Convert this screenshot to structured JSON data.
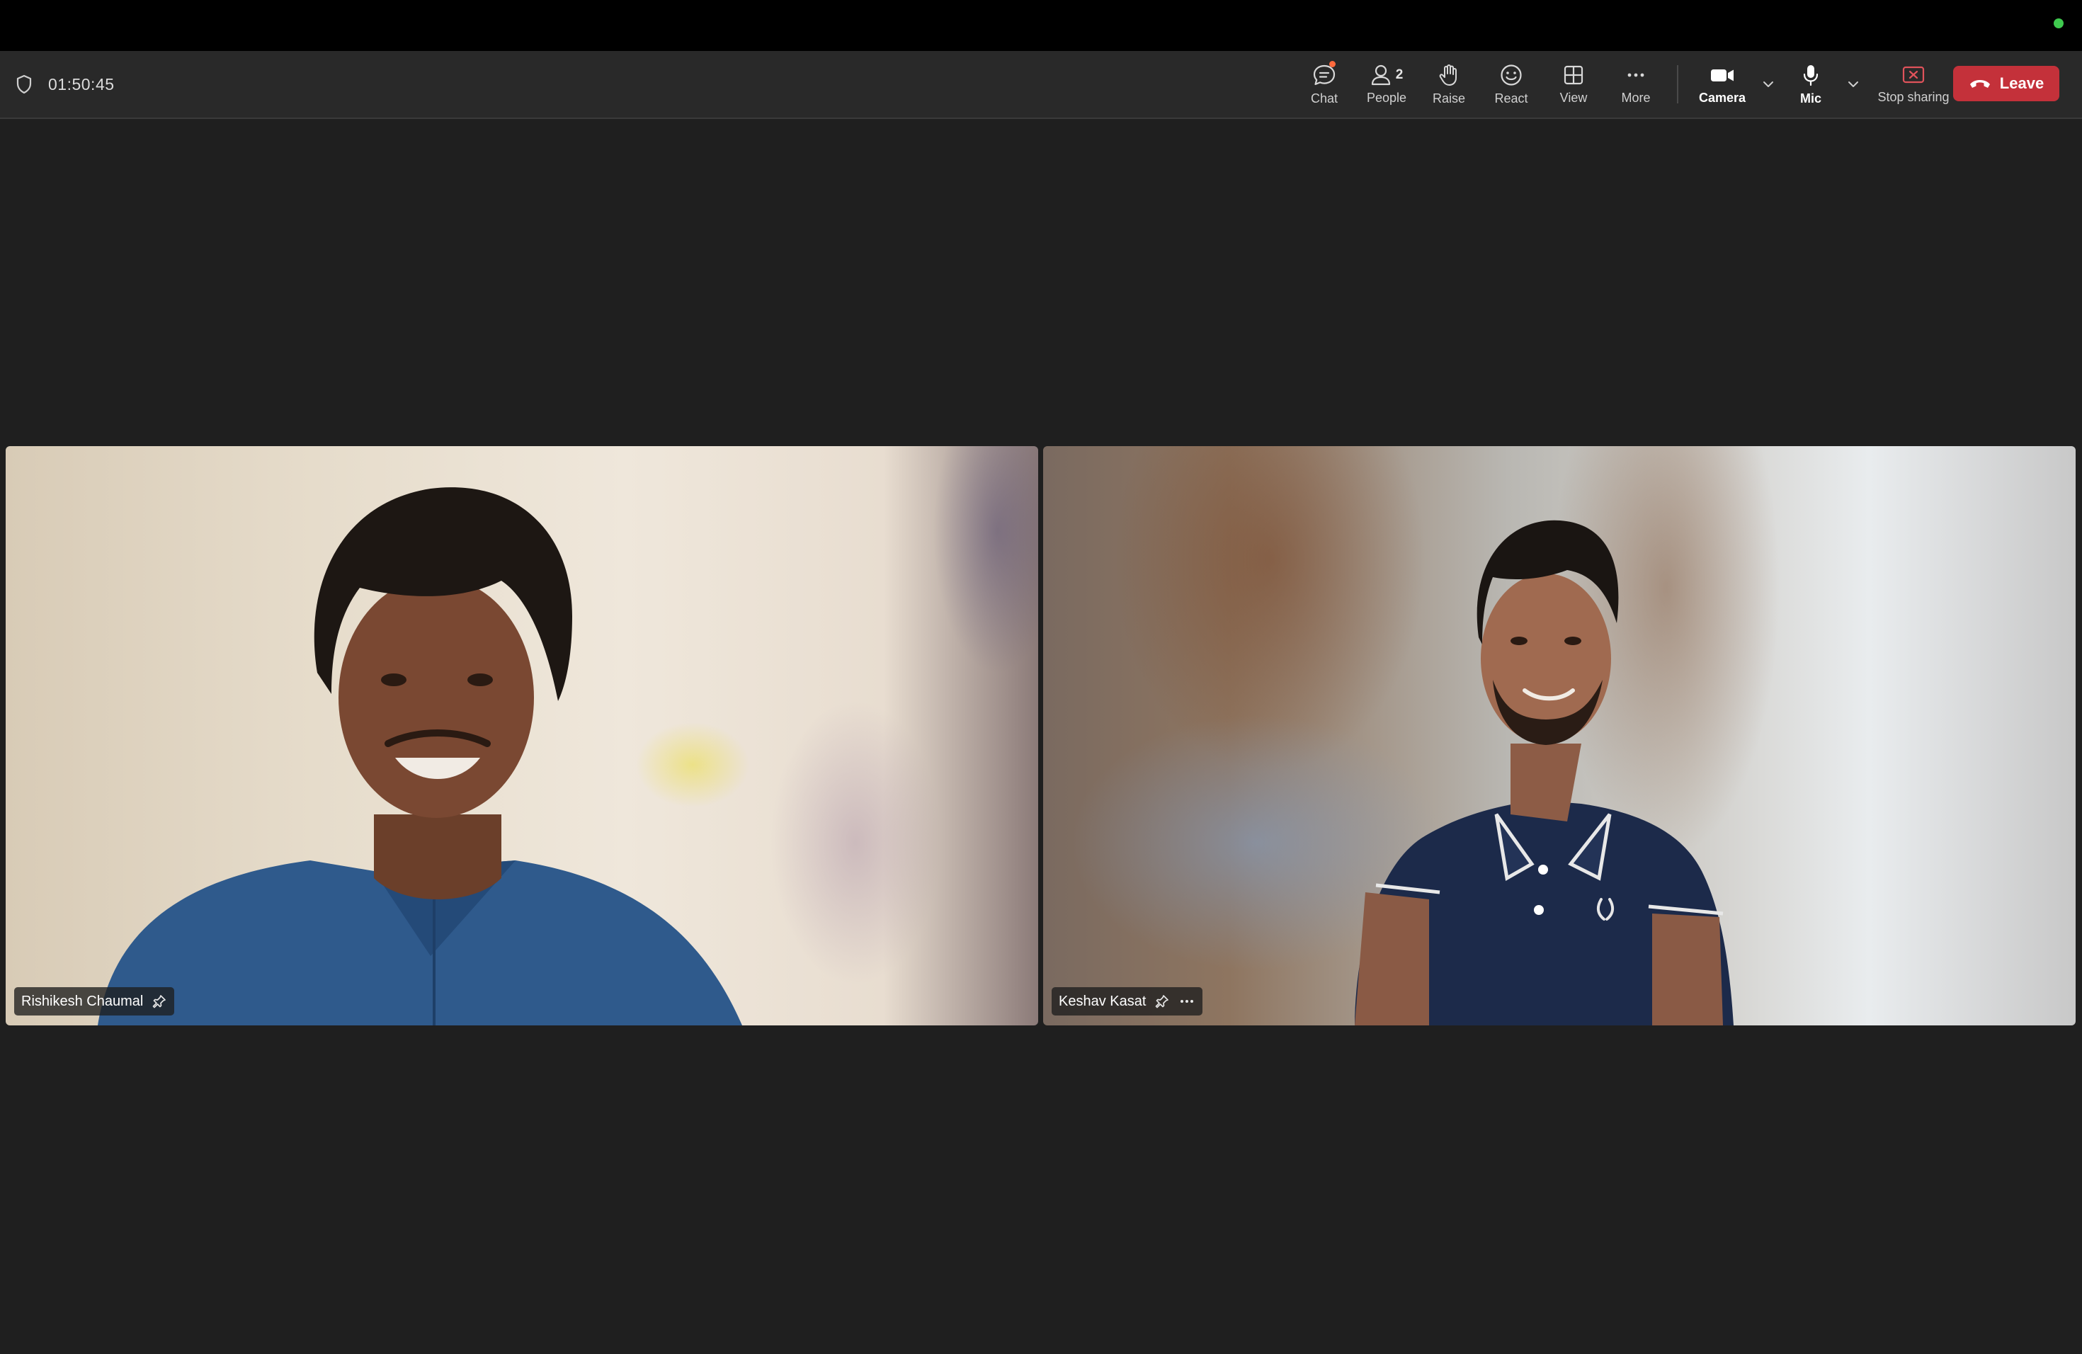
{
  "meeting": {
    "elapsed": "01:50:45"
  },
  "toolbar": {
    "chat_label": "Chat",
    "people_label": "People",
    "people_count": "2",
    "raise_label": "Raise",
    "react_label": "React",
    "view_label": "View",
    "more_label": "More",
    "camera_label": "Camera",
    "mic_label": "Mic",
    "stop_sharing_label": "Stop sharing",
    "leave_label": "Leave"
  },
  "colors": {
    "leave": "#c4313a",
    "chat_notification": "#ff6a3d",
    "status_online": "#3fca4f",
    "stop_sharing": "#e0535b"
  },
  "participants": [
    {
      "name": "Rishikesh Chaumal"
    },
    {
      "name": "Keshav Kasat"
    }
  ]
}
